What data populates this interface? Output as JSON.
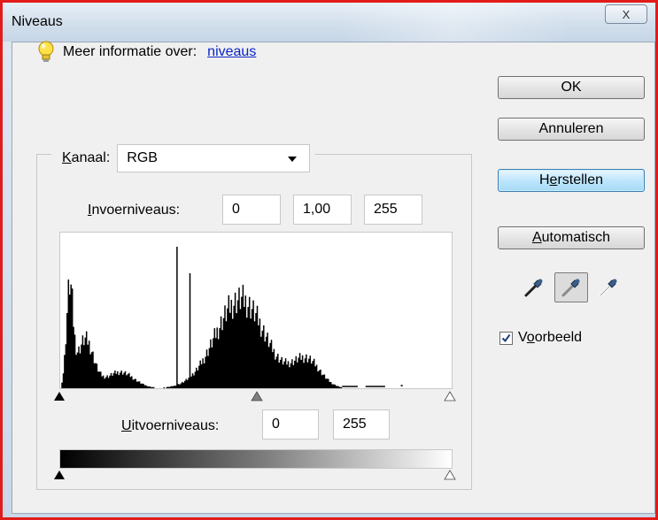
{
  "window": {
    "title": "Niveaus",
    "close_label": "X"
  },
  "info": {
    "text": "Meer informatie over:",
    "link": "niveaus"
  },
  "buttons": {
    "ok": "OK",
    "cancel": "Annuleren",
    "reset_pre": "H",
    "reset_key": "e",
    "reset_post": "rstellen",
    "auto_key": "A",
    "auto_post": "utomatisch"
  },
  "channel": {
    "label_key": "K",
    "label_post": "anaal:",
    "value": "RGB"
  },
  "input_levels": {
    "label_key": "I",
    "label_post": "nvoerniveaus:",
    "black": "0",
    "gamma": "1,00",
    "white": "255"
  },
  "output_levels": {
    "label_key": "U",
    "label_post": "itvoerniveaus:",
    "black": "0",
    "white": "255"
  },
  "preview": {
    "label_pre": "V",
    "label_key": "o",
    "label_post": "orbeeld",
    "checked": true
  },
  "icons": {
    "bulb": "lightbulb-icon",
    "black_point": "black-eyedropper-icon",
    "gray_point": "gray-eyedropper-icon",
    "white_point": "white-eyedropper-icon"
  }
}
